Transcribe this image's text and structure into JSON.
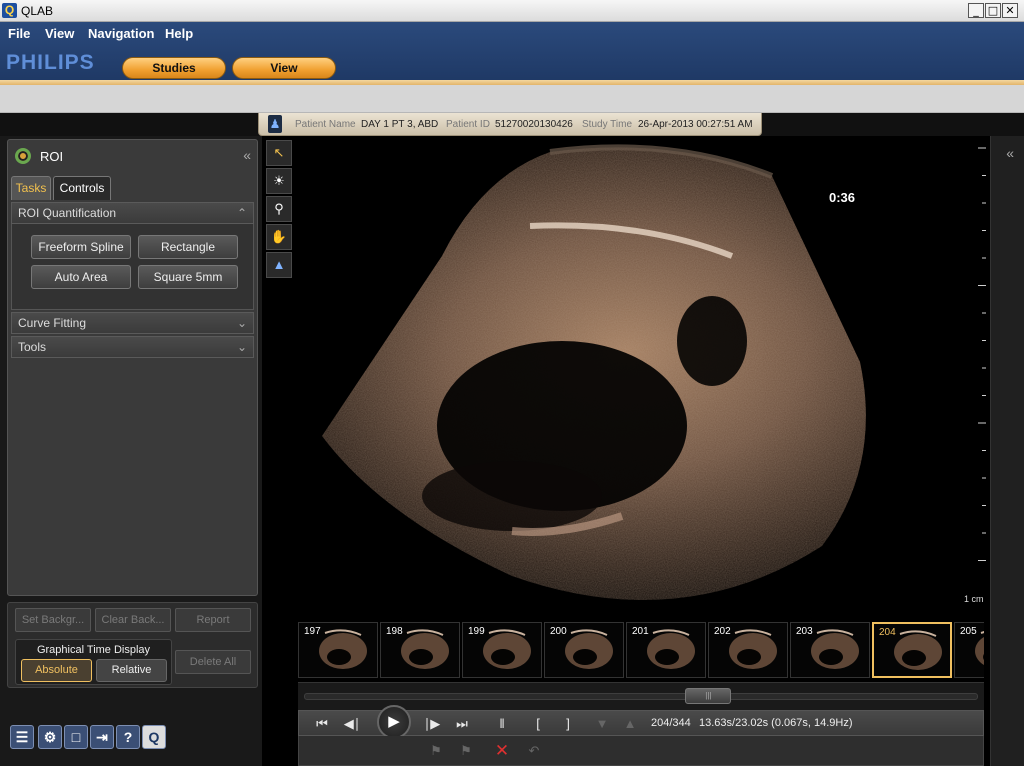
{
  "window": {
    "icon_letter": "Q",
    "title": "QLAB",
    "minimize": "_",
    "maximize": "□",
    "close": "✕"
  },
  "menu": [
    "File",
    "View",
    "Navigation",
    "Help"
  ],
  "brand": "PHILIPS",
  "tabs": [
    "Studies",
    "View"
  ],
  "patient": {
    "name_label": "Patient Name",
    "name": "DAY 1 PT 3, ABD",
    "id_label": "Patient ID",
    "id": "51270020130426",
    "time_label": "Study Time",
    "time": "26-Apr-2013 00:27:51 AM"
  },
  "roi_panel": {
    "title": "ROI",
    "subtabs": [
      "Tasks",
      "Controls"
    ],
    "sections": [
      "ROI Quantification",
      "Curve Fitting",
      "Tools"
    ],
    "quant_buttons": [
      "Freeform Spline",
      "Rectangle",
      "Auto Area",
      "Square 5mm"
    ],
    "lower_buttons": [
      "Set Backgr...",
      "Clear Back...",
      "Report"
    ],
    "graphical_time_display": {
      "title": "Graphical Time Display",
      "options": [
        "Absolute",
        "Relative"
      ],
      "selected": "Absolute"
    },
    "delete_all": "Delete All",
    "bottom_icons": [
      "film-strip-icon",
      "gears-icon",
      "save-icon",
      "export-icon",
      "help-icon",
      "qlab-icon"
    ],
    "help_glyph": "?",
    "qlab_glyph": "Q"
  },
  "viewer": {
    "tools": [
      "pointer-icon",
      "window-level-icon",
      "zoom-icon",
      "pan-icon",
      "flip-icon"
    ],
    "clock": "0:36",
    "scale_label": "1 cm",
    "thumbnails": [
      197,
      198,
      199,
      200,
      201,
      202,
      203,
      204,
      205
    ],
    "selected_frame": 204,
    "scrub_position": 0.6
  },
  "playback": {
    "frame_text": "204/344",
    "time_text": "13.63s/23.02s (0.067s, 14.9Hz)",
    "scrub_handle": "|||"
  },
  "colors": {
    "accent_orange": "#f0a030",
    "header_blue": "#2b4a7c",
    "selection_gold": "#f0c060"
  }
}
